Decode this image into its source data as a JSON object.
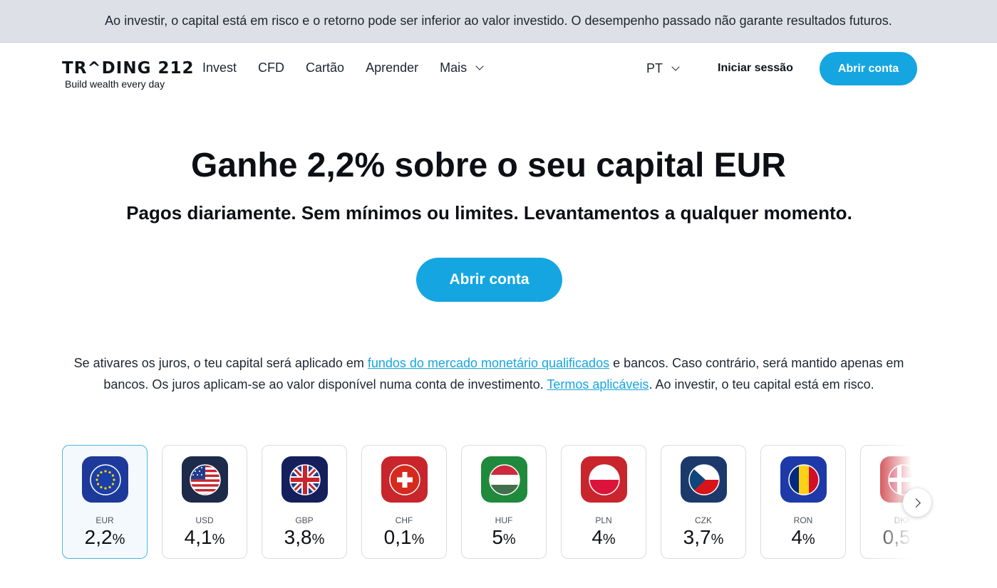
{
  "banner": {
    "text": "Ao investir, o capital está em risco e o retorno pode ser inferior ao valor investido. O desempenho passado não garante resultados futuros."
  },
  "header": {
    "logo": "TR^DING 212",
    "tagline": "Build wealth every day",
    "nav": [
      {
        "label": "Invest"
      },
      {
        "label": "CFD"
      },
      {
        "label": "Cartão"
      },
      {
        "label": "Aprender"
      },
      {
        "label": "Mais"
      }
    ],
    "language": "PT",
    "login": "Iniciar sessão",
    "open_account": "Abrir conta"
  },
  "hero": {
    "title": "Ganhe 2,2% sobre o seu capital EUR",
    "subtitle": "Pagos diariamente. Sem mínimos ou limites. Levantamentos a qualquer momento.",
    "cta": "Abrir conta"
  },
  "disclaimer": {
    "part1": "Se ativares os juros, o teu capital será aplicado em ",
    "link1": "fundos do mercado monetário qualificados",
    "part2": " e bancos. Caso contrário, será mantido apenas em bancos. Os juros aplicam-se ao valor disponível numa conta de investimento. ",
    "link2": "Termos aplicáveis",
    "part3": ". Ao investir, o teu capital está em risco."
  },
  "currencies": [
    {
      "code": "EUR",
      "rate": "2,2",
      "unit": "%",
      "flag": "eu-flag-icon",
      "bg": "#1d3a9a"
    },
    {
      "code": "USD",
      "rate": "4,1",
      "unit": "%",
      "flag": "us-flag-icon",
      "bg": "#1e2a4a"
    },
    {
      "code": "GBP",
      "rate": "3,8",
      "unit": "%",
      "flag": "gb-flag-icon",
      "bg": "#141f5c"
    },
    {
      "code": "CHF",
      "rate": "0,1",
      "unit": "%",
      "flag": "ch-flag-icon",
      "bg": "#c8252c"
    },
    {
      "code": "HUF",
      "rate": "5",
      "unit": "%",
      "flag": "hu-flag-icon",
      "bg": "#1f8a3b"
    },
    {
      "code": "PLN",
      "rate": "4",
      "unit": "%",
      "flag": "pl-flag-icon",
      "bg": "#c8252c"
    },
    {
      "code": "CZK",
      "rate": "3,7",
      "unit": "%",
      "flag": "cz-flag-icon",
      "bg": "#1b3a6b"
    },
    {
      "code": "RON",
      "rate": "4",
      "unit": "%",
      "flag": "ro-flag-icon",
      "bg": "#1e3aa8"
    },
    {
      "code": "DKK",
      "rate": "0,5",
      "unit": "%",
      "flag": "dk-flag-icon",
      "bg": "#c8252c"
    }
  ],
  "colors": {
    "accent": "#15a6e1",
    "banner_bg": "#dde1e7"
  }
}
